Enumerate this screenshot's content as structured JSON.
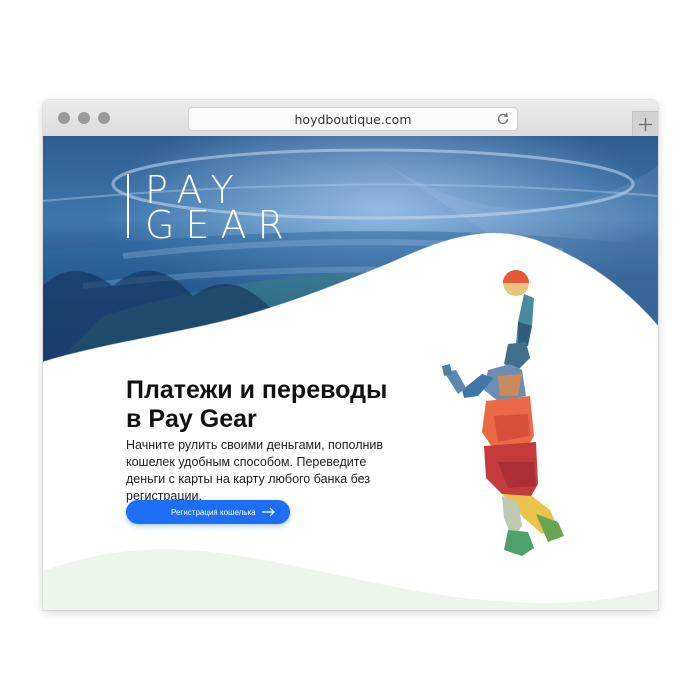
{
  "browser": {
    "url": "hoydboutique.com",
    "reload_icon": "reload-icon",
    "new_tab_icon": "plus-icon",
    "window_controls": [
      "close",
      "minimize",
      "zoom"
    ]
  },
  "brand": {
    "logo_line1": "PAY",
    "logo_line2": "GEAR"
  },
  "hero": {
    "headline_line1": "Платежи и переводы",
    "headline_line2": "в Pay Gear",
    "description": "Начните рулить своими деньгами, пополнив кошелек удобным способом. Переведите деньги с карты на карту любого банка без регистрации.",
    "cta_label": "Регистрация кошелька",
    "cta_icon": "arrow-right-icon",
    "illustration": "basketball-player-lowpoly"
  },
  "colors": {
    "accent": "#1c6ef2",
    "hero_blue": "#1d4a82",
    "text": "#111111"
  }
}
